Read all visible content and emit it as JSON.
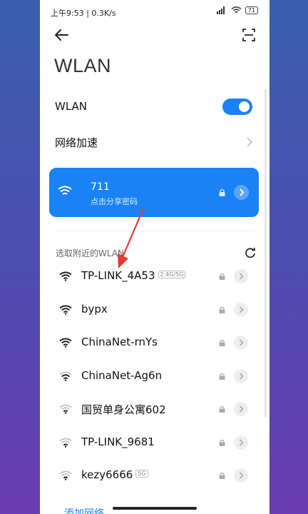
{
  "status_bar": {
    "time": "上午9:53",
    "network_speed": "0.3K/s",
    "battery": "71"
  },
  "header": {
    "back_icon": "arrow-left-icon",
    "scan_icon": "scan-icon"
  },
  "page_title": "WLAN",
  "wlan_toggle": {
    "label": "WLAN",
    "on": true
  },
  "network_accel": {
    "label": "网络加速"
  },
  "connected_network": {
    "ssid": "711",
    "subtitle": "点击分享密码"
  },
  "nearby_section": {
    "label": "选取附近的WLAN"
  },
  "networks": [
    {
      "name": "TP-LINK_4A53",
      "badge": "2.4G/5G",
      "signal": 4
    },
    {
      "name": "bypx",
      "badge": "",
      "signal": 4
    },
    {
      "name": "ChinaNet-rnYs",
      "badge": "",
      "signal": 4
    },
    {
      "name": "ChinaNet-Ag6n",
      "badge": "",
      "signal": 3
    },
    {
      "name": "国贸单身公寓602",
      "badge": "",
      "signal": 2
    },
    {
      "name": "TP-LINK_9681",
      "badge": "",
      "signal": 2
    },
    {
      "name": "kezy6666",
      "badge": "5G",
      "signal": 2
    }
  ],
  "add_network": {
    "label": "添加网络"
  },
  "colors": {
    "accent": "#1a82f4",
    "annotation_arrow": "#e53935"
  }
}
